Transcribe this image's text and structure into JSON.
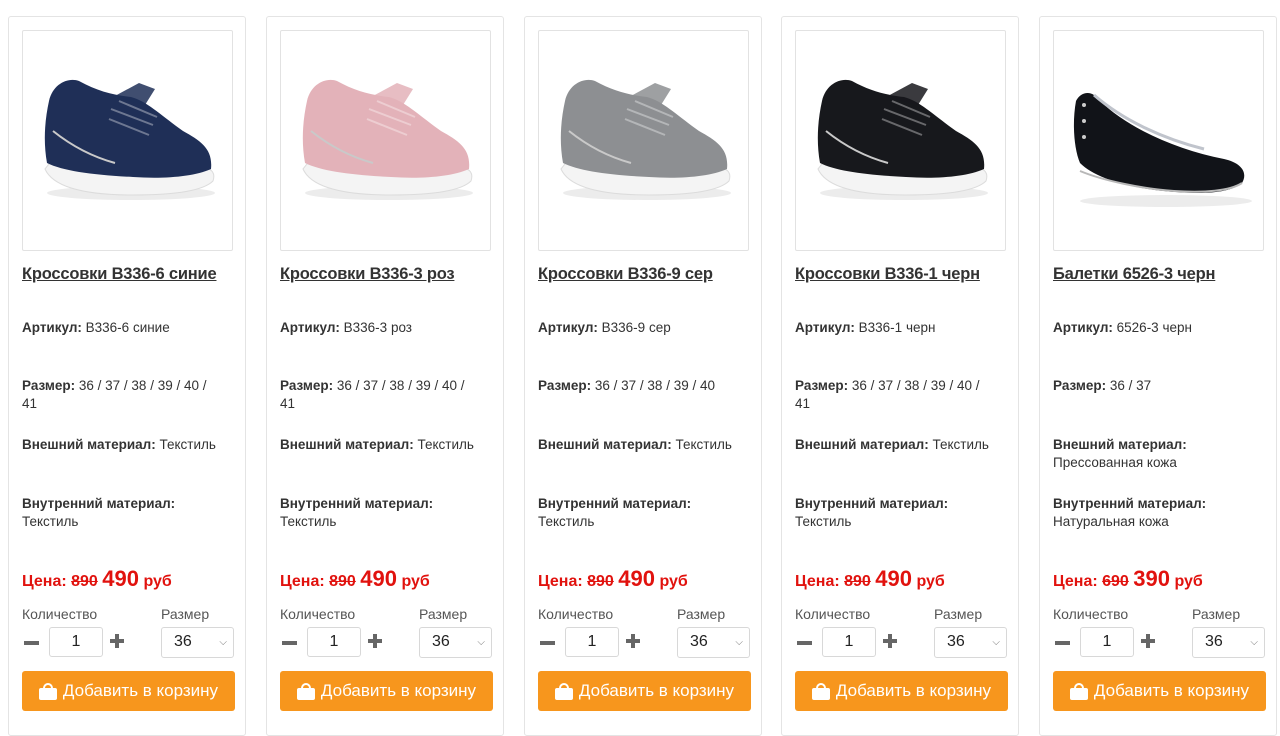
{
  "labels": {
    "article": "Артикул:",
    "size": "Размер:",
    "outer": "Внешний материал:",
    "inner": "Внутренний материал:",
    "price": "Цена:",
    "qty": "Количество",
    "size_select": "Размер",
    "add_to_cart": "Добавить в корзину"
  },
  "colors": {
    "accent": "#f7961d",
    "price": "#e1120e"
  },
  "products": [
    {
      "title": "Кроссовки B336-6 синие",
      "article": "B336-6 синие",
      "sizes_line1": "36 / 37 / 38 / 39 / 40 /",
      "sizes_line2": "41",
      "outer_line1": "Текстиль",
      "outer_line2": "",
      "inner_value": "Текстиль",
      "old_price": "890",
      "new_price": "490",
      "currency": "руб",
      "quantity": "1",
      "size_selected": "36",
      "shoe_color": "#1f2f57"
    },
    {
      "title": "Кроссовки B336-3 роз",
      "article": "B336-3 роз",
      "sizes_line1": "36 / 37 / 38 / 39 / 40 /",
      "sizes_line2": "41",
      "outer_line1": "Текстиль",
      "outer_line2": "",
      "inner_value": "Текстиль",
      "old_price": "890",
      "new_price": "490",
      "currency": "руб",
      "quantity": "1",
      "size_selected": "36",
      "shoe_color": "#e3b2b9"
    },
    {
      "title": "Кроссовки B336-9 сер",
      "article": "B336-9 сер",
      "sizes_line1": "36 / 37 / 38 / 39 / 40",
      "sizes_line2": "",
      "outer_line1": "Текстиль",
      "outer_line2": "",
      "inner_value": "Текстиль",
      "old_price": "890",
      "new_price": "490",
      "currency": "руб",
      "quantity": "1",
      "size_selected": "36",
      "shoe_color": "#8d8f92"
    },
    {
      "title": "Кроссовки B336-1 черн",
      "article": "B336-1 черн",
      "sizes_line1": "36 / 37 / 38 / 39 / 40 /",
      "sizes_line2": "41",
      "outer_line1": "Текстиль",
      "outer_line2": "",
      "inner_value": "Текстиль",
      "old_price": "890",
      "new_price": "490",
      "currency": "руб",
      "quantity": "1",
      "size_selected": "36",
      "shoe_color": "#17181c"
    },
    {
      "title": "Балетки 6526-3 черн",
      "article": "6526-3 черн",
      "sizes_line1": "36 / 37",
      "sizes_line2": "",
      "outer_line1": "",
      "outer_line2": "Прессованная кожа",
      "inner_value": "Натуральная кожа",
      "old_price": "690",
      "new_price": "390",
      "currency": "руб",
      "quantity": "1",
      "size_selected": "36",
      "shoe_color": "#111318"
    }
  ]
}
